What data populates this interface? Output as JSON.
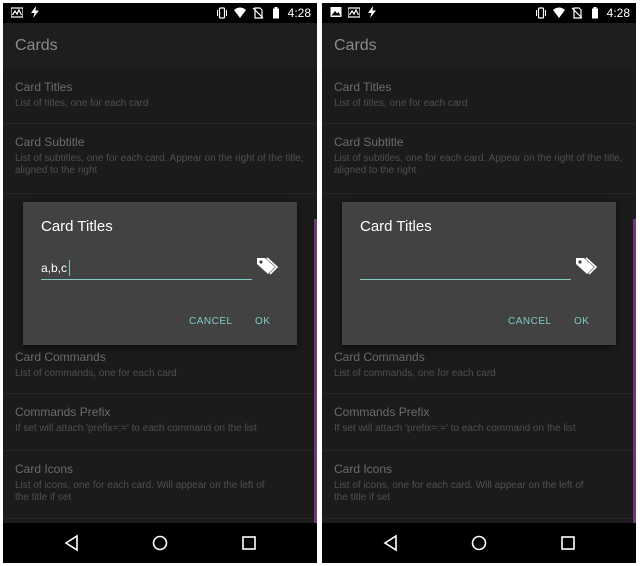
{
  "status": {
    "time": "4:28"
  },
  "toolbar": {
    "title": "Cards"
  },
  "preferences": [
    {
      "title": "Card Titles",
      "summary": "List of titles, one for each card"
    },
    {
      "title": "Card Subtitle",
      "summary": "List of subtitles, one for each card. Appear on the right of the title, aligned to the right"
    },
    {
      "title": "Card Commands",
      "summary": "List of commands, one for each card"
    },
    {
      "title": "Commands Prefix",
      "summary": "If set will attach 'prefix=:=' to each command on the list"
    },
    {
      "title": "Card Icons",
      "summary": "List of icons, one for each card. Will appear on the left of the title if set"
    }
  ],
  "dialog": {
    "title": "Card Titles",
    "cancel_label": "CANCEL",
    "ok_label": "OK"
  },
  "screens": [
    {
      "input_value": "a,b,c"
    },
    {
      "input_value": ""
    }
  ],
  "colors": {
    "accent": "#7fcac3",
    "scrollbar": "#6b3a78"
  },
  "icons": [
    "image-icon",
    "signal-meter-icon",
    "flash-icon",
    "vibrate-icon",
    "wifi-icon",
    "no-sim-icon",
    "battery-icon",
    "tag-icon",
    "back-icon",
    "home-icon",
    "recents-icon"
  ]
}
